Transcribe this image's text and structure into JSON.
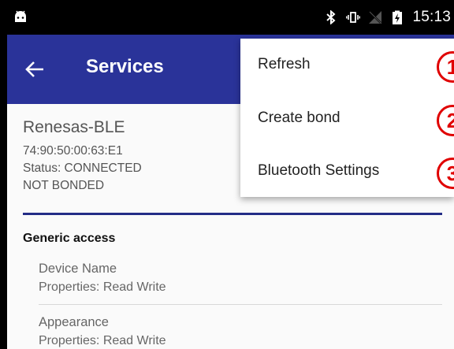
{
  "status_bar": {
    "time": "15:13",
    "icons": [
      "android-icon",
      "bluetooth-icon",
      "vibrate-icon",
      "no-signal-icon",
      "battery-charging-icon"
    ]
  },
  "app_bar": {
    "title": "Services",
    "back_icon": "arrow-left-icon",
    "color": "#2a3399"
  },
  "device": {
    "name": "Renesas-BLE",
    "address": "74:90:50:00:63:E1",
    "status": "Status:  CONNECTED",
    "bond": "NOT BONDED"
  },
  "services": [
    {
      "title": "Generic access",
      "characteristics": [
        {
          "name": "Device Name",
          "properties": "Properties: Read Write"
        },
        {
          "name": "Appearance",
          "properties": "Properties: Read Write"
        }
      ]
    }
  ],
  "menu": {
    "items": [
      {
        "label": "Refresh",
        "badge": "1"
      },
      {
        "label": "Create bond",
        "badge": "2"
      },
      {
        "label": "Bluetooth Settings",
        "badge": "3"
      }
    ]
  },
  "colors": {
    "accent": "#2a3399",
    "divider": "#232c86",
    "badge": "#e00000"
  }
}
